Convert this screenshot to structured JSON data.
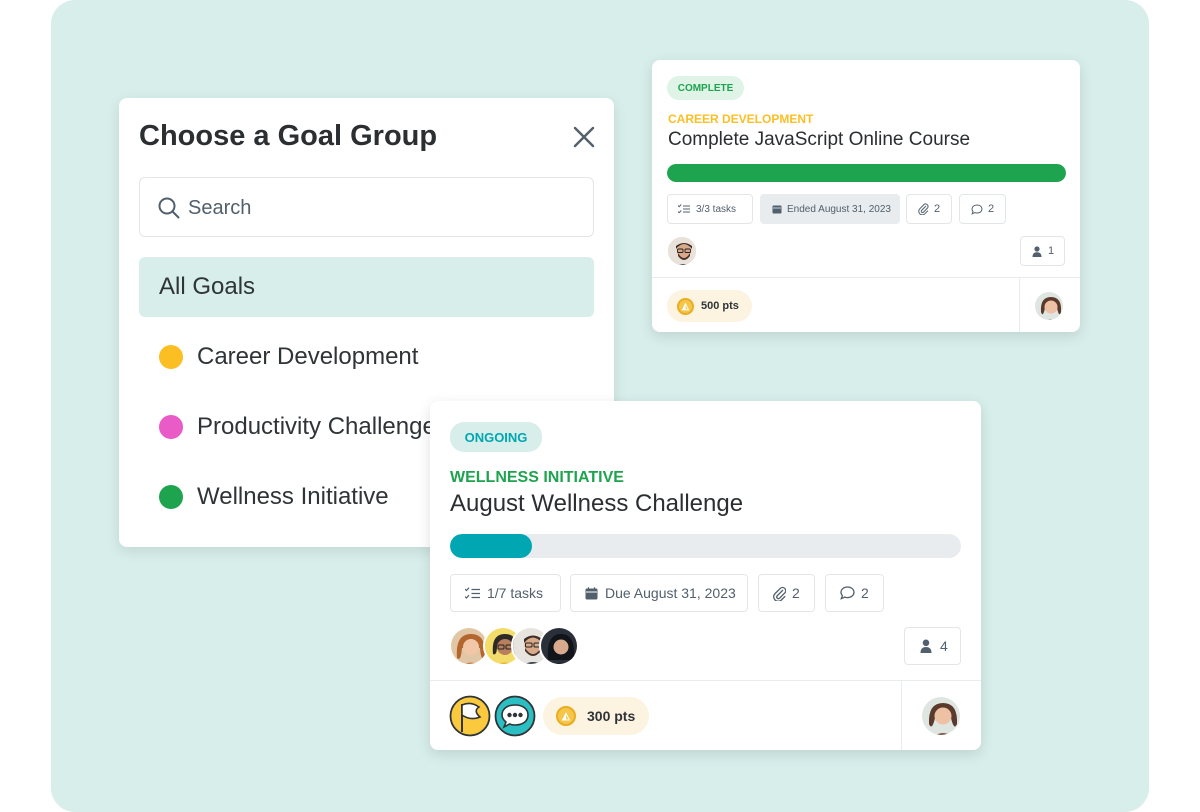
{
  "goal_group_panel": {
    "title": "Choose a Goal Group",
    "search_placeholder": "Search",
    "items": [
      {
        "label": "All Goals",
        "active": true
      },
      {
        "label": "Career Development",
        "color": "#fbbf24"
      },
      {
        "label": "Productivity Challenge",
        "color": "#e95bc6"
      },
      {
        "label": "Wellness Initiative",
        "color": "#1ea34f"
      }
    ]
  },
  "card_complete": {
    "status": "COMPLETE",
    "category": "CAREER DEVELOPMENT",
    "title": "Complete JavaScript Online Course",
    "progress": 1.0,
    "tasks": "3/3 tasks",
    "date": "Ended August 31, 2023",
    "attachments": "2",
    "comments": "2",
    "members": "1",
    "points": "500 pts"
  },
  "card_ongoing": {
    "status": "ONGOING",
    "category": "WELLNESS INITIATIVE",
    "title": "August Wellness Challenge",
    "progress": 0.16,
    "tasks": "1/7 tasks",
    "date": "Due August 31, 2023",
    "attachments": "2",
    "comments": "2",
    "members": "4",
    "points": "300 pts"
  },
  "colors": {
    "background": "#d8eeeb",
    "complete_green": "#1ea34f",
    "ongoing_teal": "#00a7b3",
    "career_yellow": "#fbbf24"
  },
  "icons": [
    "search-icon",
    "close-icon",
    "task-list-icon",
    "calendar-icon",
    "paperclip-icon",
    "comment-icon",
    "person-icon",
    "coin-icon",
    "flag-badge-icon",
    "chat-badge-icon"
  ]
}
